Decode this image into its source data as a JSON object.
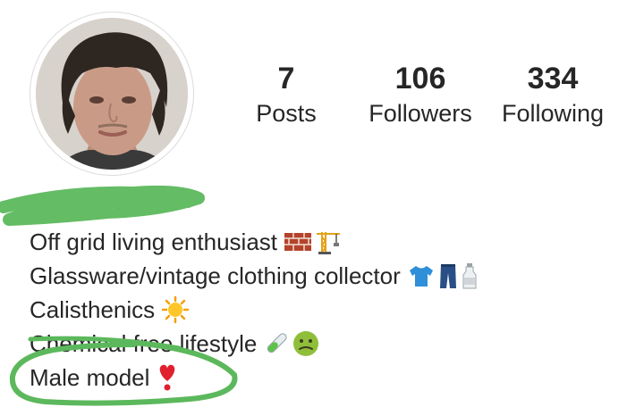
{
  "profile": {
    "stats": [
      {
        "value": "7",
        "label": "Posts"
      },
      {
        "value": "106",
        "label": "Followers"
      },
      {
        "value": "334",
        "label": "Following"
      }
    ],
    "bio": [
      {
        "text": "Off grid living enthusiast",
        "emojis": [
          "brick-icon",
          "construction-crane-icon"
        ]
      },
      {
        "text": "Glassware/vintage clothing collector",
        "emojis": [
          "tshirt-icon",
          "jeans-icon",
          "milk-bottle-icon"
        ]
      },
      {
        "text": "Calisthenics",
        "emojis": [
          "sun-icon"
        ]
      },
      {
        "text": "Chemical free lifestyle",
        "emojis": [
          "test-tube-icon",
          "nauseated-face-icon"
        ]
      },
      {
        "text": "Male model",
        "emojis": [
          "exclamation-heart-icon"
        ]
      }
    ]
  },
  "colors": {
    "text": "#262626",
    "scribble": "#5cb85c"
  }
}
